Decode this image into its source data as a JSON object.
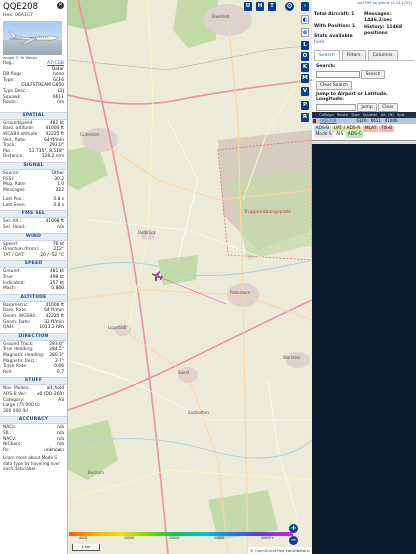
{
  "aircraft": {
    "callsign": "QQE208",
    "hex_label": "Hex:",
    "hex": "06A1C7",
    "photo_credit": "Image © Yu Wenjie",
    "close_icon": "close-icon"
  },
  "details": [
    {
      "k": "Reg.:",
      "v": "A7-CGB",
      "link": true
    },
    {
      "k": "",
      "v": "Qatar"
    },
    {
      "k": "DB flags:",
      "v": "none"
    },
    {
      "k": "Type:",
      "v": "GLF6"
    },
    {
      "k": "",
      "v": "GULFSTREAM G650"
    },
    {
      "k": "Type Desc.:",
      "v": "L2J"
    },
    {
      "k": "Squawk:",
      "v": "6611"
    },
    {
      "k": "Route:",
      "v": "n/a"
    }
  ],
  "sections": [
    {
      "title": "SPATIAL",
      "rows": [
        {
          "k": "Groundspeed:",
          "v": "481 kt"
        },
        {
          "k": "Baro. altitude:",
          "v": "41000 ft"
        },
        {
          "k": "WGS84 altitude:",
          "v": "42225 ft"
        },
        {
          "k": "Vert. Rate:",
          "v": "64 ft/min"
        },
        {
          "k": "Track:",
          "v": "293.0°"
        },
        {
          "k": "Pos.:",
          "v": "51.735°, 8.518°"
        },
        {
          "k": "Distance:",
          "v": "128.2 nmi"
        }
      ]
    },
    {
      "title": "SIGNAL",
      "rows": [
        {
          "k": "Source:",
          "v": "Other"
        },
        {
          "k": "RSSI:",
          "v": "-30.2"
        },
        {
          "k": "Msg. Rate:",
          "v": "1.0"
        },
        {
          "k": "Messages:",
          "v": "222"
        },
        {
          "gap": true
        },
        {
          "k": "Last Pos.:",
          "v": "0.8 s"
        },
        {
          "k": "Last Seen:",
          "v": "0.8 s"
        }
      ]
    },
    {
      "title": "FMS SEL",
      "rows": [
        {
          "k": "Sel. Alt.:",
          "v": "41008 ft"
        },
        {
          "k": "Sel. Head.:",
          "v": "n/a"
        }
      ]
    },
    {
      "title": "WIND",
      "rows": [
        {
          "k": "Speed:",
          "v": "76 kt"
        },
        {
          "k": "Direction (from):",
          "v": "212°"
        },
        {
          "k": "TAT / OAT:",
          "v": "-20 / -52 °C"
        }
      ]
    },
    {
      "title": "SPEED",
      "rows": [
        {
          "k": "Ground:",
          "v": "481 kt"
        },
        {
          "k": "True:",
          "v": "498 kt"
        },
        {
          "k": "Indicated:",
          "v": "257 kt"
        },
        {
          "k": "Mach:",
          "v": "0.860"
        }
      ]
    },
    {
      "title": "ALTITUDE",
      "rows": [
        {
          "k": "Barometric:",
          "v": "41000 ft"
        },
        {
          "k": "Baro. Rate:",
          "v": "64 ft/min"
        },
        {
          "k": "Geom. WGS84:",
          "v": "42225 ft"
        },
        {
          "k": "Geom. Rate:",
          "v": "32 ft/min"
        },
        {
          "k": "QNH:",
          "v": "1013.2 hPa"
        }
      ]
    },
    {
      "title": "DIRECTION",
      "rows": [
        {
          "k": "Ground Track:",
          "v": "293.0°"
        },
        {
          "k": "True Heading:",
          "v": "284.5°"
        },
        {
          "k": "Magnetic Heading:",
          "v": "280.3°"
        },
        {
          "k": "Magnetic Decl.:",
          "v": "3.7°"
        },
        {
          "k": "Track Rate:",
          "v": "0.06"
        },
        {
          "k": "Roll:",
          "v": "0.7"
        }
      ]
    },
    {
      "title": "STUFF",
      "rows": [
        {
          "k": "Nav. Modes:",
          "v": "alt_hold"
        },
        {
          "k": "ADS-B Ver.:",
          "v": "v0 (DO-260)"
        },
        {
          "k": "Category:",
          "v": "A3"
        },
        {
          "k": "Large (75 000 to",
          "v": ""
        },
        {
          "k": "300 000 lb)",
          "v": ""
        }
      ]
    },
    {
      "title": "ACCURACY",
      "rows": [
        {
          "k": "NACp:",
          "v": "n/a"
        },
        {
          "k": "SIL:",
          "v": "n/a"
        },
        {
          "k": "NACv:",
          "v": "n/a"
        },
        {
          "k": "NICbaro:",
          "v": "n/a"
        },
        {
          "k": "Rc:",
          "v": "unknown"
        }
      ]
    }
  ],
  "note": "Learn more about Mode S data type by hovering over each data label.",
  "map": {
    "top_buttons": [
      "U",
      "H",
      "T"
    ],
    "side_buttons": [
      "L",
      "O",
      "K",
      "M",
      "V",
      "P",
      "R"
    ],
    "places": [
      "Gütersloh",
      "Bielefeld",
      "Truppenübungsplatz",
      "Paderborn",
      "Lippstadt",
      "Soest",
      "Warstein",
      "Delbrück",
      "Salzkotten",
      "Beckum"
    ],
    "scale": "2 km",
    "attribution_prefix": "© ",
    "attribution_link": "OpenStreetMap",
    "attribution_suffix": " contributors.",
    "zoom_in": "+",
    "zoom_out": "−",
    "legend_labels": [
      "4000",
      "10000",
      "20000",
      "30000",
      "40000+"
    ],
    "gear_icon": "gear-icon"
  },
  "right": {
    "top_link": "tar1090 on github (3.14.1702)",
    "total_aircraft": "Total Aircraft: 1",
    "with_position": "With Position: 1",
    "stats": "Stats available",
    "stats_link": "here",
    "messages": "Messages: 1446.2/sec",
    "history": "History: 11468 positions",
    "tabs": [
      "Search",
      "Filters",
      "Columns"
    ],
    "search_label": "Search:",
    "search_button": "Search",
    "clear_search": "Clear Search",
    "jump_label": "Jump to Airport or Latitude, Longitude:",
    "jump_button": "Jump",
    "clear_button": "Clear",
    "table_headers": [
      "Callsign",
      "Route",
      "Type",
      "Squawk",
      "Alt. (ft)",
      "Spd."
    ],
    "row": {
      "callsign": "QQE208",
      "type": "GLF6",
      "squawk": "6611",
      "alt": "41000"
    },
    "sources": [
      "ADS-B",
      "UAT / ADS-R",
      "MLAT",
      "TIS-B",
      "Mode S",
      "AIS",
      "ADS-C"
    ],
    "source_colors": [
      "#c0e0f0",
      "#e0e0a0",
      "#f0c0a0",
      "#f0b8b8",
      "#e8e8e8",
      "#ffffff",
      "#b8e8b8"
    ]
  }
}
